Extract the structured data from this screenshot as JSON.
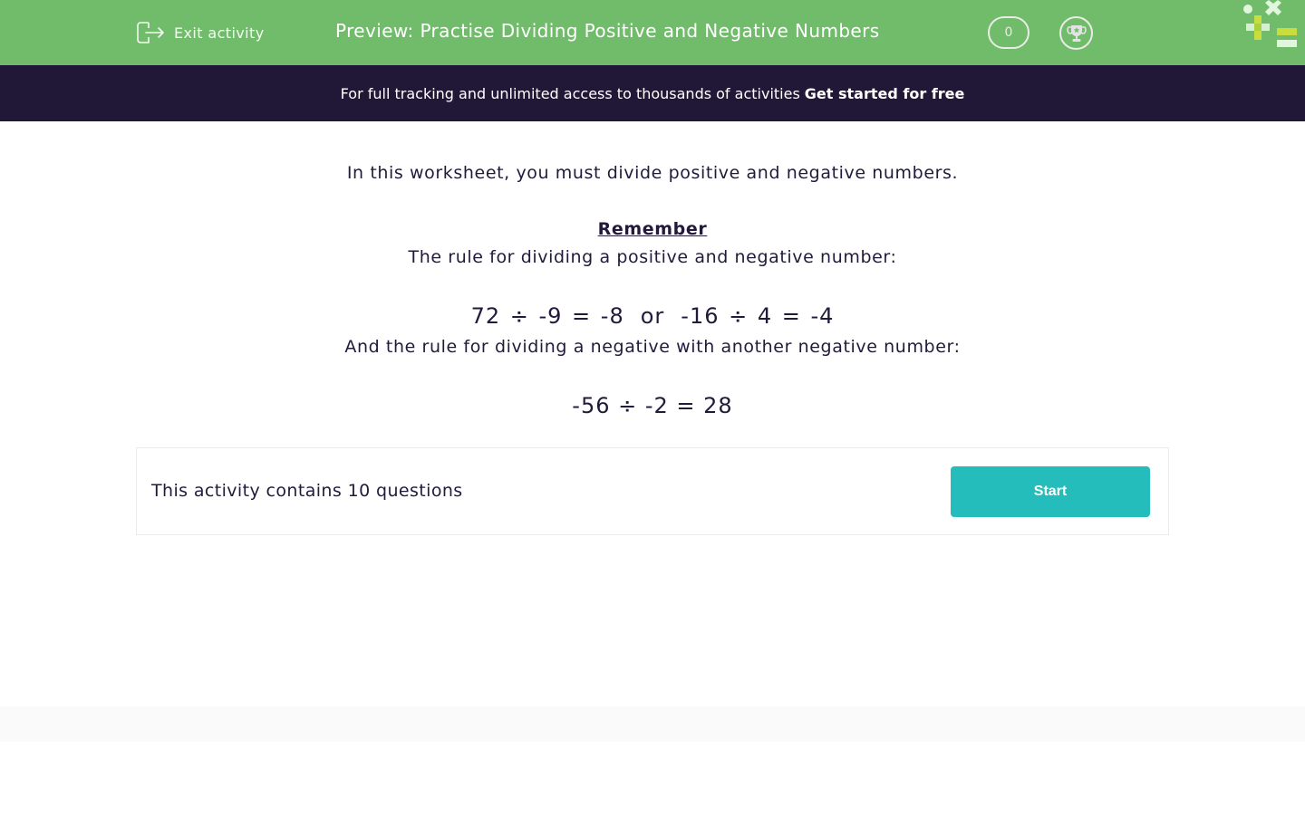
{
  "header": {
    "exit_label": "Exit activity",
    "title": "Preview: Practise Dividing Positive and Negative Numbers",
    "score": "0",
    "icons": [
      "exit-icon",
      "trophy-icon",
      "maths-symbols-logo"
    ]
  },
  "banner": {
    "text": "For full tracking and unlimited access to thousands of activities",
    "cta": "Get started for free"
  },
  "intro": {
    "line1": "In this worksheet, you must divide positive and negative numbers.",
    "remember": "Remember",
    "rule1": "The rule for dividing a positive and negative number:",
    "example1a": "72 ÷ -9 = -8",
    "or": "or",
    "example1b": "-16 ÷ 4 = -4",
    "rule2": "And the rule for dividing a negative with another negative number:",
    "example2": "-56 ÷ -2 = 28"
  },
  "activity": {
    "count_text": "This activity contains 10 questions",
    "start_label": "Start"
  },
  "colors": {
    "header_green": "#71bc6b",
    "banner_dark": "#211838",
    "start_teal": "#25bdbb",
    "text_dark": "#231a3b"
  }
}
